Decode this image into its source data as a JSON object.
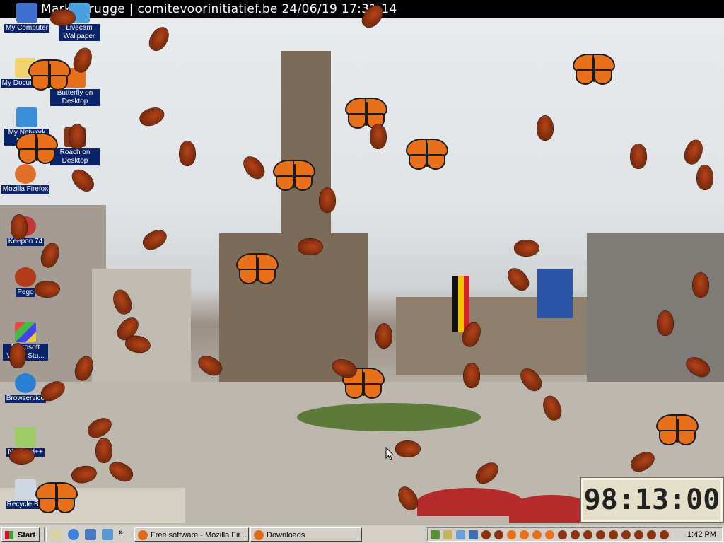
{
  "webcam": {
    "banner": "Markt Brugge | comitevoorinitiatief.be 24/06/19 17:31:14"
  },
  "desktop_icons": [
    {
      "label": "My Computer",
      "icon": "computer-icon"
    },
    {
      "label": "Livecam Wallpaper",
      "icon": "livecam-icon"
    },
    {
      "label": "My Documents",
      "icon": "folder-icon"
    },
    {
      "label": "Butterfly on Desktop",
      "icon": "butterfly-icon"
    },
    {
      "label": "My Network Places",
      "icon": "network-icon"
    },
    {
      "label": "Roach on Desktop",
      "icon": "roach-icon"
    },
    {
      "label": "Mozilla Firefox",
      "icon": "firefox-icon"
    },
    {
      "label": "Keepon 74",
      "icon": "app-icon"
    },
    {
      "label": "Pego",
      "icon": "app-icon"
    },
    {
      "label": "Microsoft Visual Stu...",
      "icon": "visualstudio-icon"
    },
    {
      "label": "Browservice",
      "icon": "browser-icon"
    },
    {
      "label": "Notepad++",
      "icon": "notepad-icon"
    },
    {
      "label": "Recycle Bin",
      "icon": "recycle-bin-icon"
    }
  ],
  "clock_widget": {
    "display": "98:13:00"
  },
  "taskbar": {
    "start_label": "Start",
    "tasks": [
      {
        "label": "Free software - Mozilla Fir...",
        "icon": "firefox-icon"
      },
      {
        "label": "Downloads",
        "icon": "firefox-icon"
      }
    ],
    "time": "1:42 PM"
  }
}
